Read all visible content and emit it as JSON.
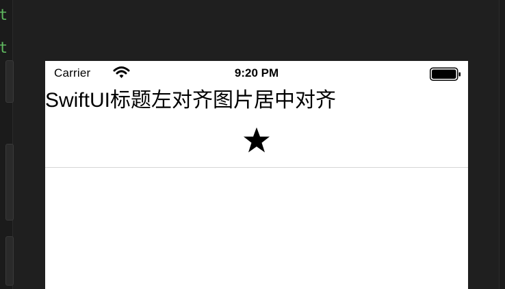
{
  "status_bar": {
    "carrier": "Carrier",
    "time": "9:20 PM",
    "wifi_icon": "wifi-icon",
    "battery_icon": "battery-full-icon"
  },
  "content": {
    "title": "SwiftUI标题左对齐图片居中对齐",
    "image_icon": "star-icon"
  },
  "ide": {
    "code_snippets": [
      "t",
      "t"
    ]
  },
  "colors": {
    "ide_background": "#1f1f1f",
    "code_text": "#5fb85f",
    "simulator_background": "#ffffff",
    "separator": "#d6d6d6"
  }
}
